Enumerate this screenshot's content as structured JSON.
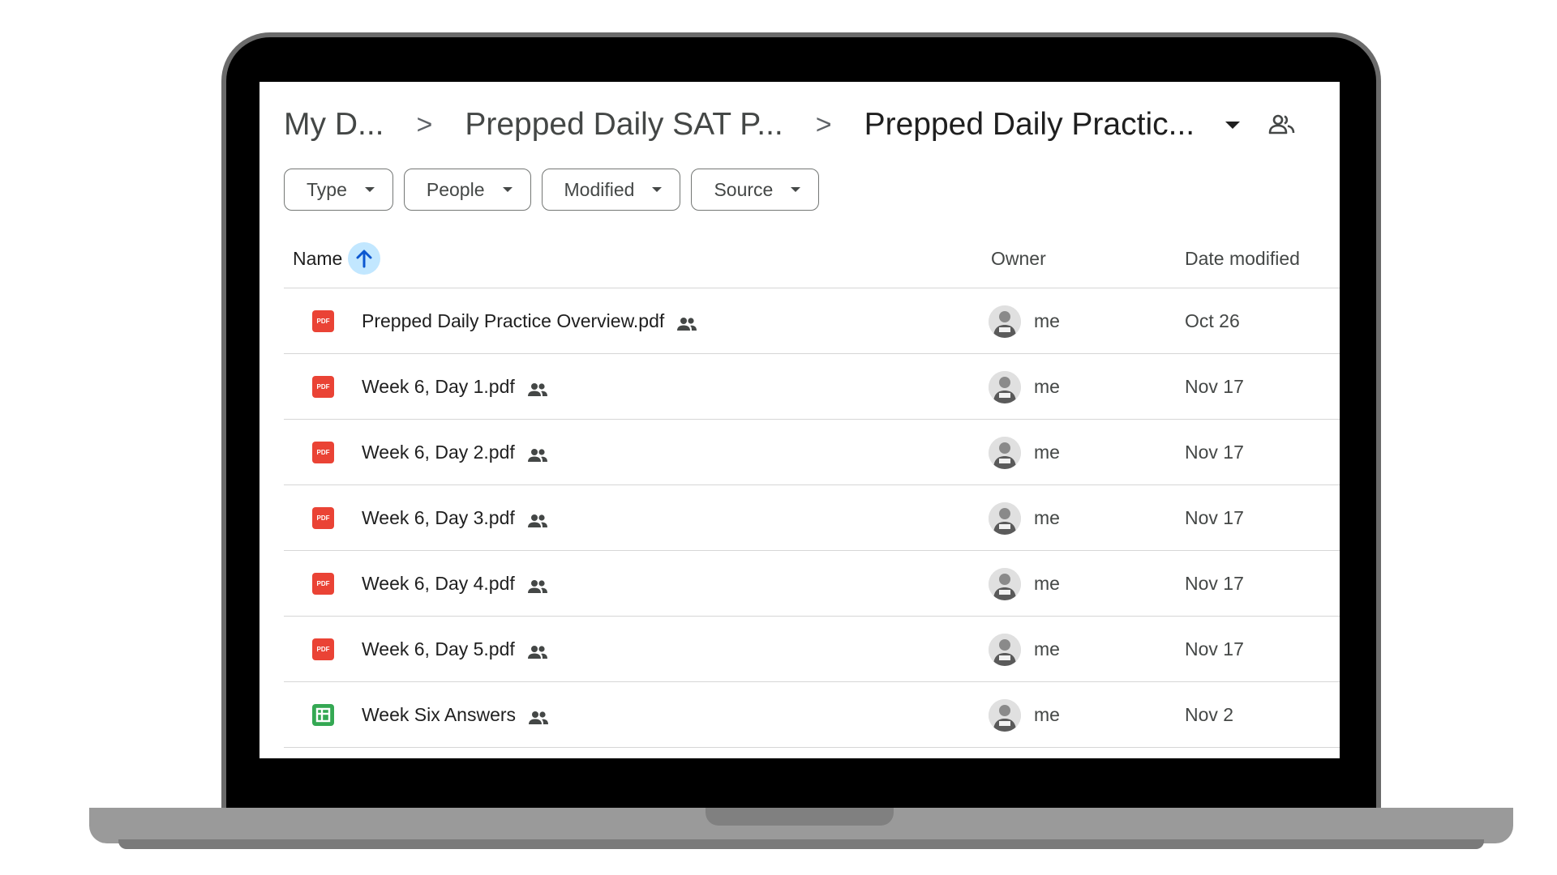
{
  "breadcrumb": {
    "items": [
      "My D...",
      "Prepped Daily SAT P...",
      "Prepped Daily Practic..."
    ],
    "separator": ">"
  },
  "filters": [
    {
      "label": "Type"
    },
    {
      "label": "People"
    },
    {
      "label": "Modified"
    },
    {
      "label": "Source"
    }
  ],
  "table": {
    "headers": {
      "name": "Name",
      "owner": "Owner",
      "date_modified": "Date modified"
    },
    "sort": {
      "column": "Name",
      "direction": "ascending",
      "icon": "arrow-up-icon"
    },
    "rows": [
      {
        "type": "pdf",
        "icon": "PDF",
        "name": "Prepped Daily Practice Overview.pdf",
        "shared": true,
        "owner": "me",
        "date": "Oct 26"
      },
      {
        "type": "pdf",
        "icon": "PDF",
        "name": "Week 6, Day 1.pdf",
        "shared": true,
        "owner": "me",
        "date": "Nov 17"
      },
      {
        "type": "pdf",
        "icon": "PDF",
        "name": "Week 6, Day 2.pdf",
        "shared": true,
        "owner": "me",
        "date": "Nov 17"
      },
      {
        "type": "pdf",
        "icon": "PDF",
        "name": "Week 6, Day 3.pdf",
        "shared": true,
        "owner": "me",
        "date": "Nov 17"
      },
      {
        "type": "pdf",
        "icon": "PDF",
        "name": "Week 6, Day 4.pdf",
        "shared": true,
        "owner": "me",
        "date": "Nov 17"
      },
      {
        "type": "pdf",
        "icon": "PDF",
        "name": "Week 6, Day 5.pdf",
        "shared": true,
        "owner": "me",
        "date": "Nov 17"
      },
      {
        "type": "sheet",
        "icon": "",
        "name": "Week Six Answers",
        "shared": true,
        "owner": "me",
        "date": "Nov 2"
      }
    ]
  },
  "colors": {
    "pdf": "#ea4335",
    "sheet": "#34a853",
    "sort_highlight": "#c2e7ff",
    "laptop_frame": "#9a9a9a",
    "bezel": "#000000"
  }
}
